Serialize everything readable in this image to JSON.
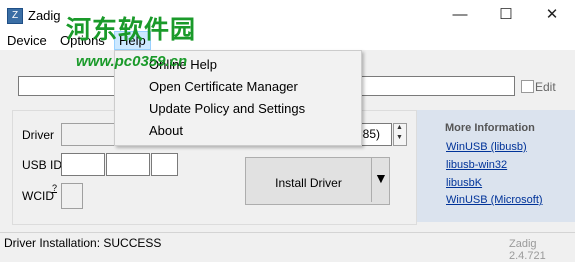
{
  "window": {
    "title": "Zadig",
    "icon_glyph": "Z",
    "minimize": "—",
    "maximize": "☐",
    "close": "✕"
  },
  "watermark": {
    "text": "河东软件园",
    "url": "www.pc0359.cn"
  },
  "menubar": {
    "device": "Device",
    "options": "Options",
    "help": "Help"
  },
  "help_menu": {
    "items": [
      "Online Help",
      "Open Certificate Manager",
      "Update Policy and Settings",
      "About"
    ]
  },
  "device_row": {
    "value": "",
    "edit_label": "Edit"
  },
  "driver_row": {
    "label": "Driver",
    "target_suffix": "385)"
  },
  "usbid_row": {
    "label": "USB ID"
  },
  "wcid_row": {
    "label": "WCID",
    "help_marker": "?"
  },
  "install": {
    "label": "Install Driver",
    "arrow": "▼"
  },
  "more_info": {
    "title": "More Information",
    "links": [
      "WinUSB (libusb)",
      "libusb-win32",
      "libusbK",
      "WinUSB (Microsoft)"
    ]
  },
  "status": {
    "text": "Driver Installation: SUCCESS",
    "version": "Zadig 2.4.721"
  },
  "colors": {
    "accent": "#cce8ff",
    "info_panel": "#dbe3ee",
    "link": "#003399",
    "watermark": "#1a9a2a"
  }
}
